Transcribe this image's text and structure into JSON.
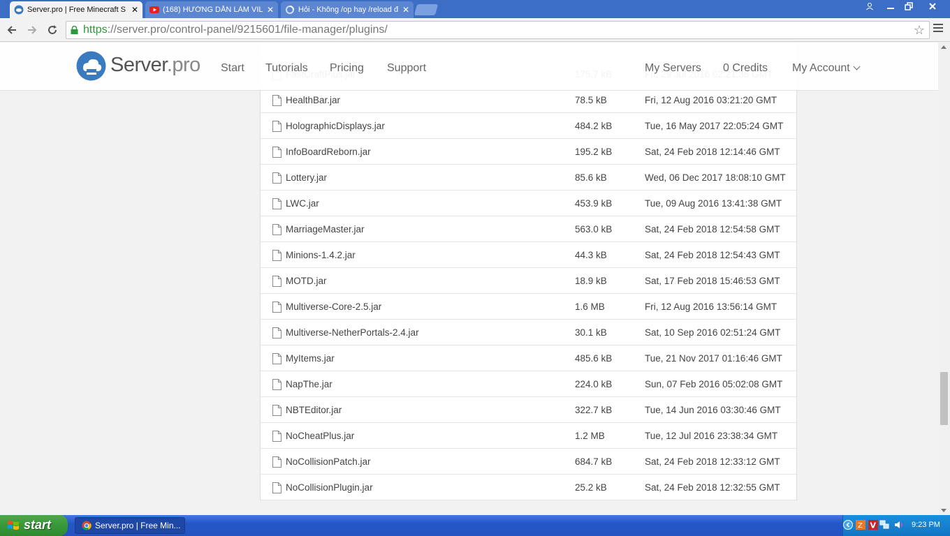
{
  "browser": {
    "tabs": [
      {
        "title": "Server.pro | Free Minecraft S",
        "active": true,
        "icon": "serverpro-favicon"
      },
      {
        "title": "(168) HƯỚNG DẪN LÀM VILL",
        "active": false,
        "icon": "youtube-icon"
      },
      {
        "title": "Hỏi - Không /op hay /reload đ",
        "active": false,
        "icon": "loading-icon"
      }
    ],
    "window_controls": [
      "user-icon",
      "minimize-icon",
      "restore-icon",
      "close-icon"
    ],
    "address": {
      "scheme": "https",
      "rest": "://server.pro/control-panel/9215601/file-manager/plugins/"
    }
  },
  "site": {
    "logo": {
      "name": "Server",
      "tld": ".pro"
    },
    "nav": [
      "Start",
      "Tutorials",
      "Pricing",
      "Support"
    ],
    "right_nav": {
      "servers": "My Servers",
      "credits": "0 Credits",
      "account": "My Account"
    }
  },
  "files": [
    {
      "name": "FastCraftPlus.jar",
      "size": "175.7 kB",
      "date": "Fri, 29 Jul 2016 02:21:38 GMT"
    },
    {
      "name": "HealthBar.jar",
      "size": "78.5 kB",
      "date": "Fri, 12 Aug 2016 03:21:20 GMT"
    },
    {
      "name": "HolographicDisplays.jar",
      "size": "484.2 kB",
      "date": "Tue, 16 May 2017 22:05:24 GMT"
    },
    {
      "name": "InfoBoardReborn.jar",
      "size": "195.2 kB",
      "date": "Sat, 24 Feb 2018 12:14:46 GMT"
    },
    {
      "name": "Lottery.jar",
      "size": "85.6 kB",
      "date": "Wed, 06 Dec 2017 18:08:10 GMT"
    },
    {
      "name": "LWC.jar",
      "size": "453.9 kB",
      "date": "Tue, 09 Aug 2016 13:41:38 GMT"
    },
    {
      "name": "MarriageMaster.jar",
      "size": "563.0 kB",
      "date": "Sat, 24 Feb 2018 12:54:58 GMT"
    },
    {
      "name": "Minions-1.4.2.jar",
      "size": "44.3 kB",
      "date": "Sat, 24 Feb 2018 12:54:43 GMT"
    },
    {
      "name": "MOTD.jar",
      "size": "18.9 kB",
      "date": "Sat, 17 Feb 2018 15:46:53 GMT"
    },
    {
      "name": "Multiverse-Core-2.5.jar",
      "size": "1.6 MB",
      "date": "Fri, 12 Aug 2016 13:56:14 GMT"
    },
    {
      "name": "Multiverse-NetherPortals-2.4.jar",
      "size": "30.1 kB",
      "date": "Sat, 10 Sep 2016 02:51:24 GMT"
    },
    {
      "name": "MyItems.jar",
      "size": "485.6 kB",
      "date": "Tue, 21 Nov 2017 01:16:46 GMT"
    },
    {
      "name": "NapThe.jar",
      "size": "224.0 kB",
      "date": "Sun, 07 Feb 2016 05:02:08 GMT"
    },
    {
      "name": "NBTEditor.jar",
      "size": "322.7 kB",
      "date": "Tue, 14 Jun 2016 03:30:46 GMT"
    },
    {
      "name": "NoCheatPlus.jar",
      "size": "1.2 MB",
      "date": "Tue, 12 Jul 2016 23:38:34 GMT"
    },
    {
      "name": "NoCollisionPatch.jar",
      "size": "684.7 kB",
      "date": "Sat, 24 Feb 2018 12:33:12 GMT"
    },
    {
      "name": "NoCollisionPlugin.jar",
      "size": "25.2 kB",
      "date": "Sat, 24 Feb 2018 12:32:55 GMT"
    }
  ],
  "taskbar": {
    "start": "start",
    "task": "Server.pro | Free Min...",
    "clock": "9:23 PM"
  },
  "colors": {
    "accent": "#3a7bbf",
    "taskbar": "#2457c6",
    "start": "#37983a"
  }
}
